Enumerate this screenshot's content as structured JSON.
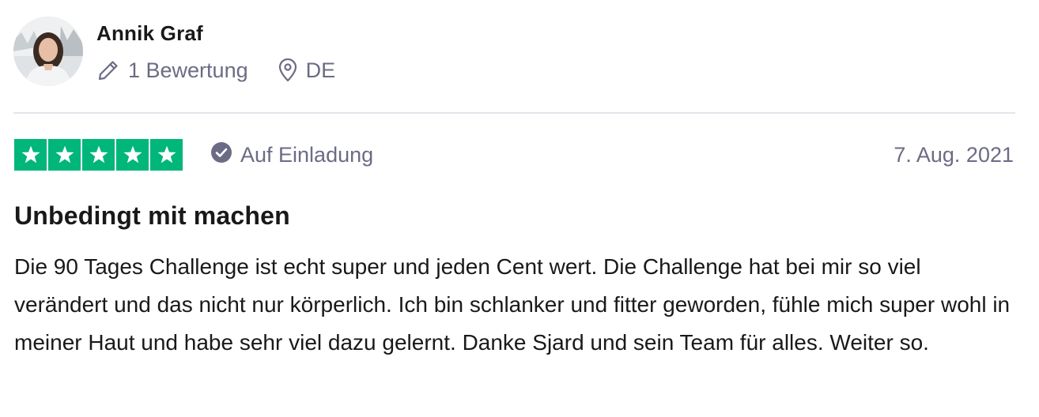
{
  "consumer": {
    "name": "Annik Graf",
    "reviews_count": "1 Bewertung",
    "country": "DE",
    "icons": {
      "reviews": "pencil-icon",
      "country": "location-pin-icon"
    }
  },
  "review": {
    "rating": 5,
    "rating_max": 5,
    "star_color": "#00b67a",
    "verification_label": "Auf Einladung",
    "verification_icon": "check-circle-icon",
    "date": "7. Aug. 2021",
    "title": "Unbedingt mit machen",
    "body": "Die 90 Tages Challenge ist echt super und jeden Cent wert. Die Challenge hat bei mir so viel verändert und das nicht nur körperlich. Ich bin schlanker und fitter geworden, fühle mich super wohl in meiner Haut und habe sehr viel dazu gelernt. Danke Sjard und sein Team für alles. Weiter so."
  },
  "colors": {
    "text_primary": "#191919",
    "text_secondary": "#6b6b85",
    "divider": "#e3e3ea"
  }
}
